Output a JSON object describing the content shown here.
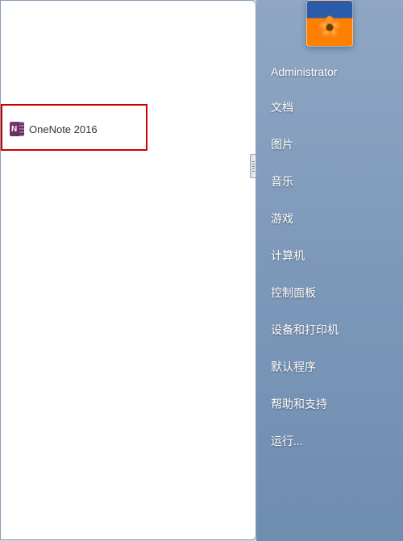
{
  "programs": {
    "onenote": {
      "label": "OneNote 2016"
    }
  },
  "user": {
    "name": "Administrator"
  },
  "rightMenu": {
    "items": [
      {
        "label": "Administrator"
      },
      {
        "label": "文档"
      },
      {
        "label": "图片"
      },
      {
        "label": "音乐"
      },
      {
        "label": "游戏"
      },
      {
        "label": "计算机"
      },
      {
        "label": "控制面板"
      },
      {
        "label": "设备和打印机"
      },
      {
        "label": "默认程序"
      },
      {
        "label": "帮助和支持"
      },
      {
        "label": "运行..."
      }
    ]
  }
}
